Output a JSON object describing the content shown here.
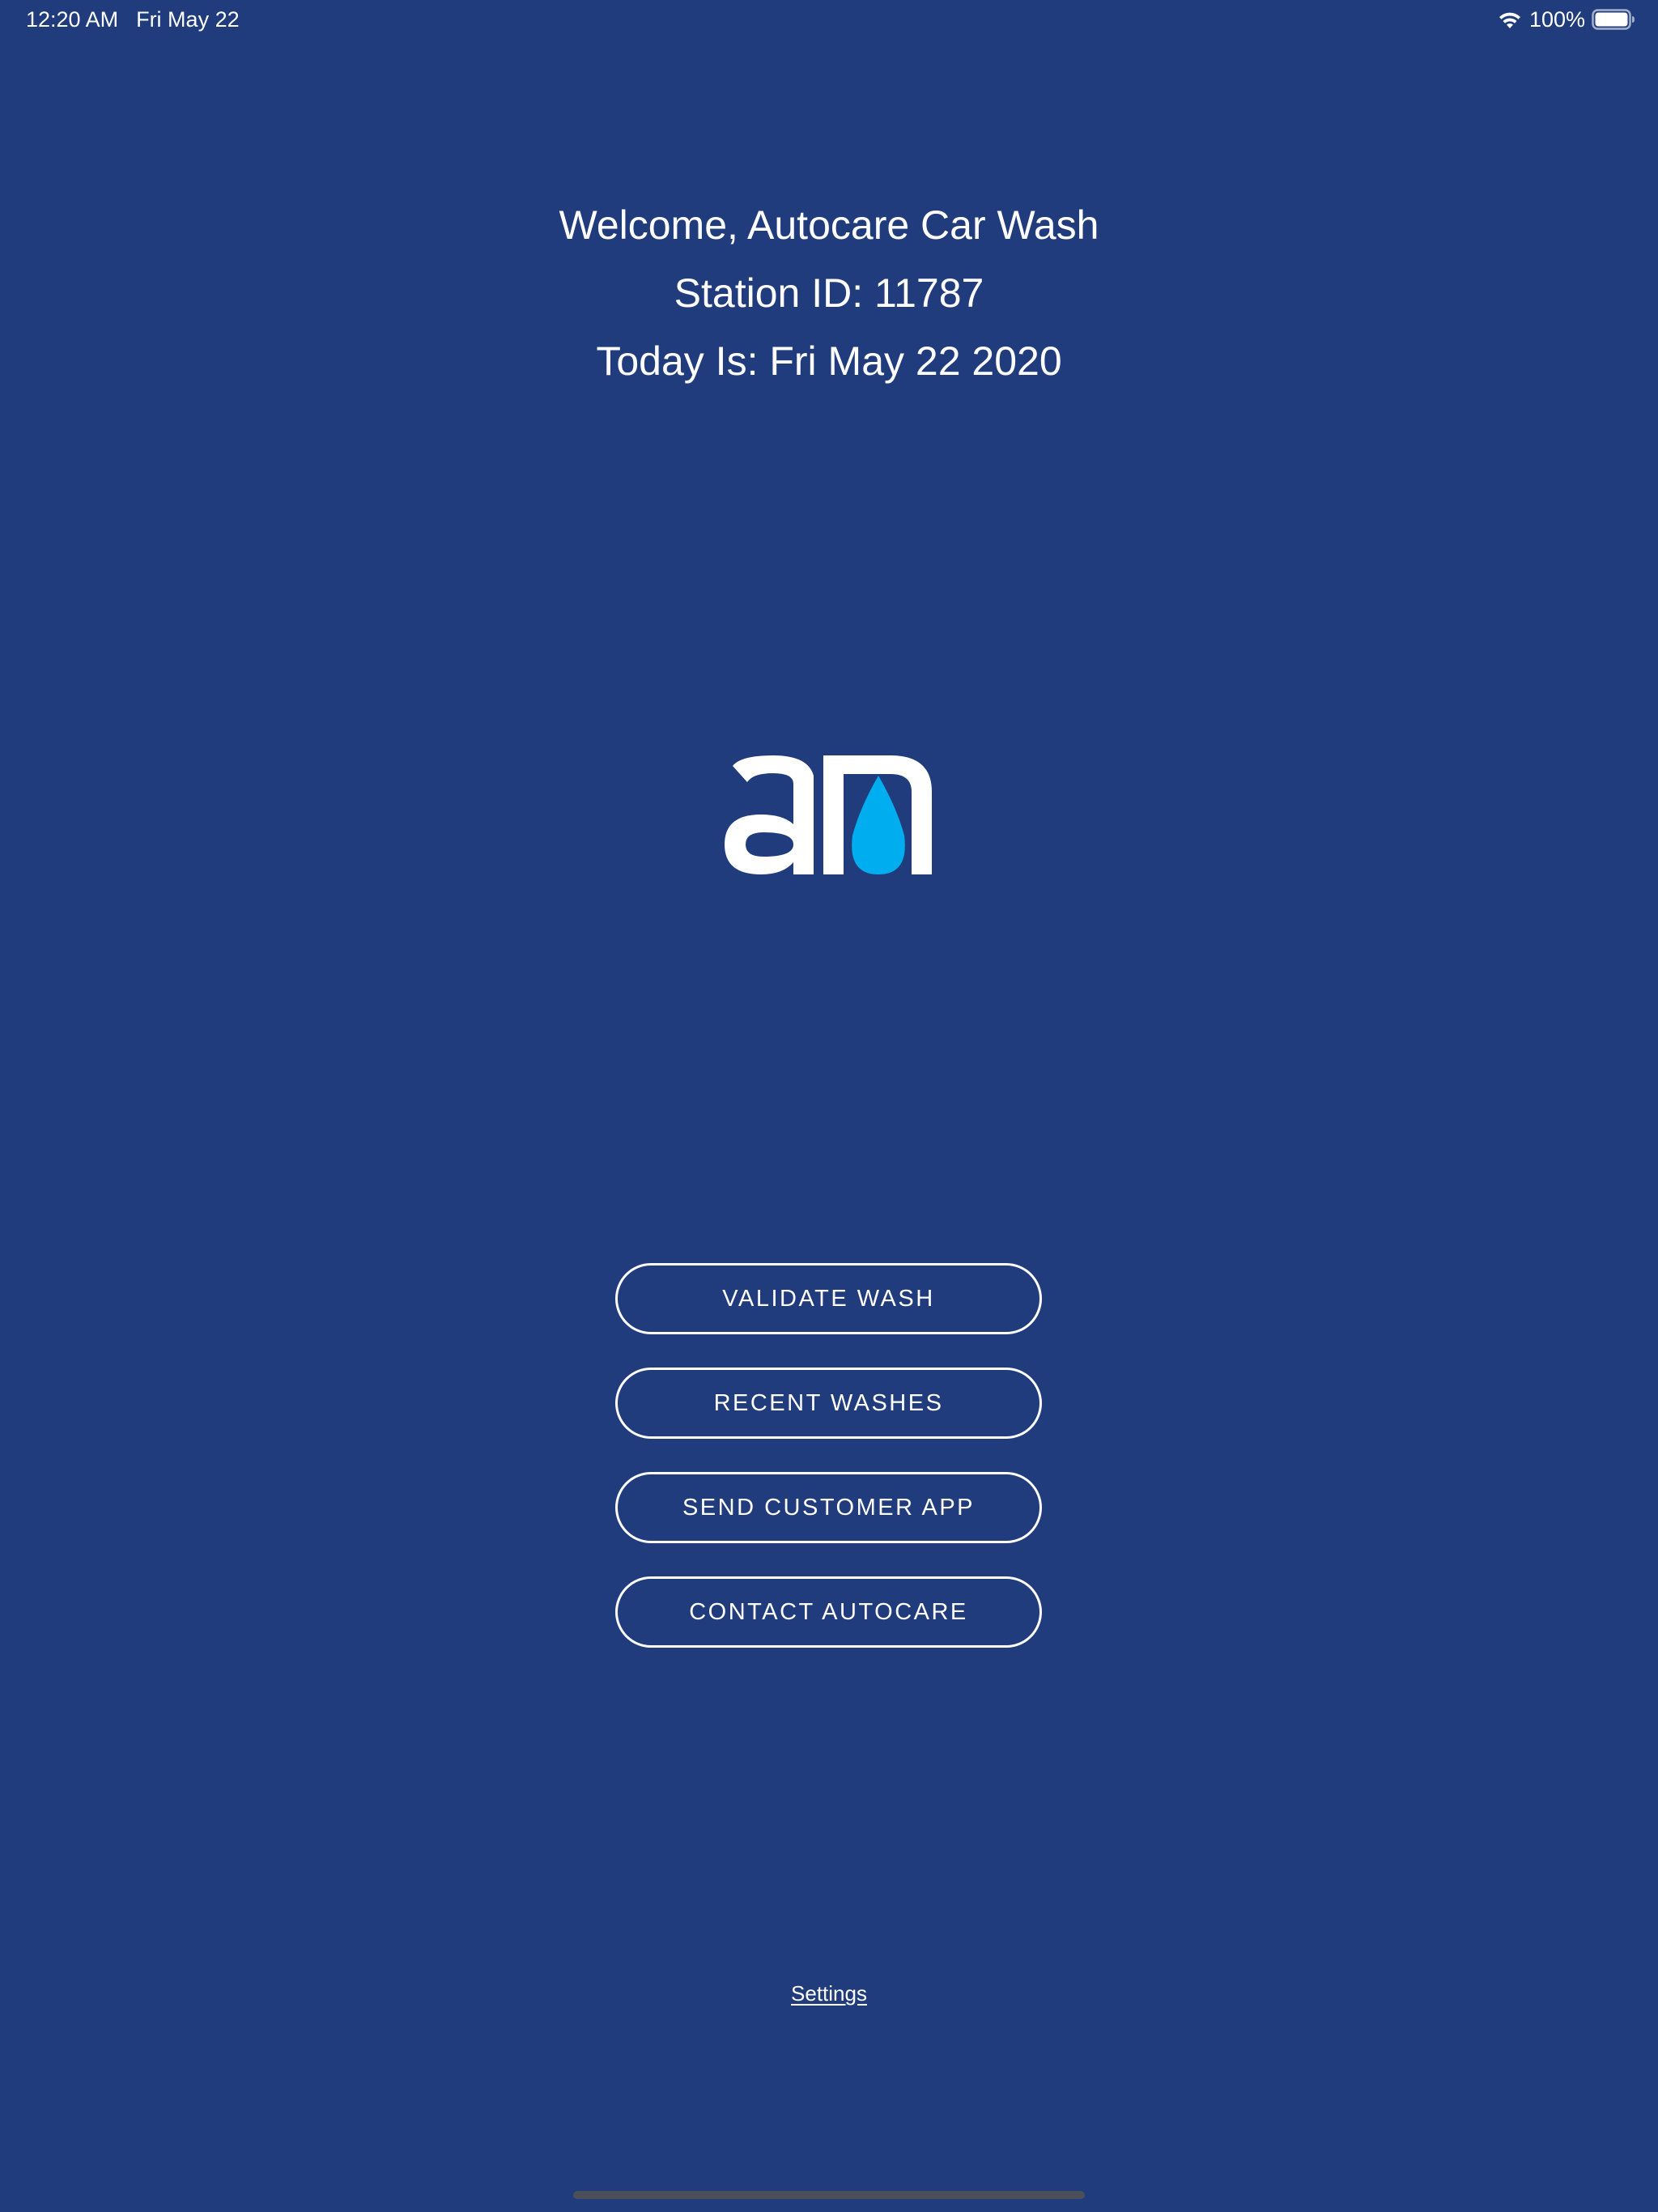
{
  "status_bar": {
    "time": "12:20 AM",
    "date": "Fri May 22",
    "wifi_icon": "wifi-icon",
    "battery_percent": "100%",
    "battery_icon": "battery-full-icon"
  },
  "welcome": {
    "greeting": "Welcome, Autocare Car Wash",
    "station": "Station ID: 11787",
    "today": "Today Is: Fri May 22 2020"
  },
  "logo": {
    "text": "an",
    "icon": "water-drop-icon",
    "color_letters": "#ffffff",
    "color_drop": "#00aeef"
  },
  "menu": {
    "buttons": [
      {
        "label": "VALIDATE WASH"
      },
      {
        "label": "RECENT WASHES"
      },
      {
        "label": "SEND CUSTOMER APP"
      },
      {
        "label": "CONTACT AUTOCARE"
      }
    ]
  },
  "footer": {
    "settings_label": "Settings"
  },
  "colors": {
    "background": "#203c7d",
    "text": "#ffffff",
    "accent": "#00aeef"
  }
}
